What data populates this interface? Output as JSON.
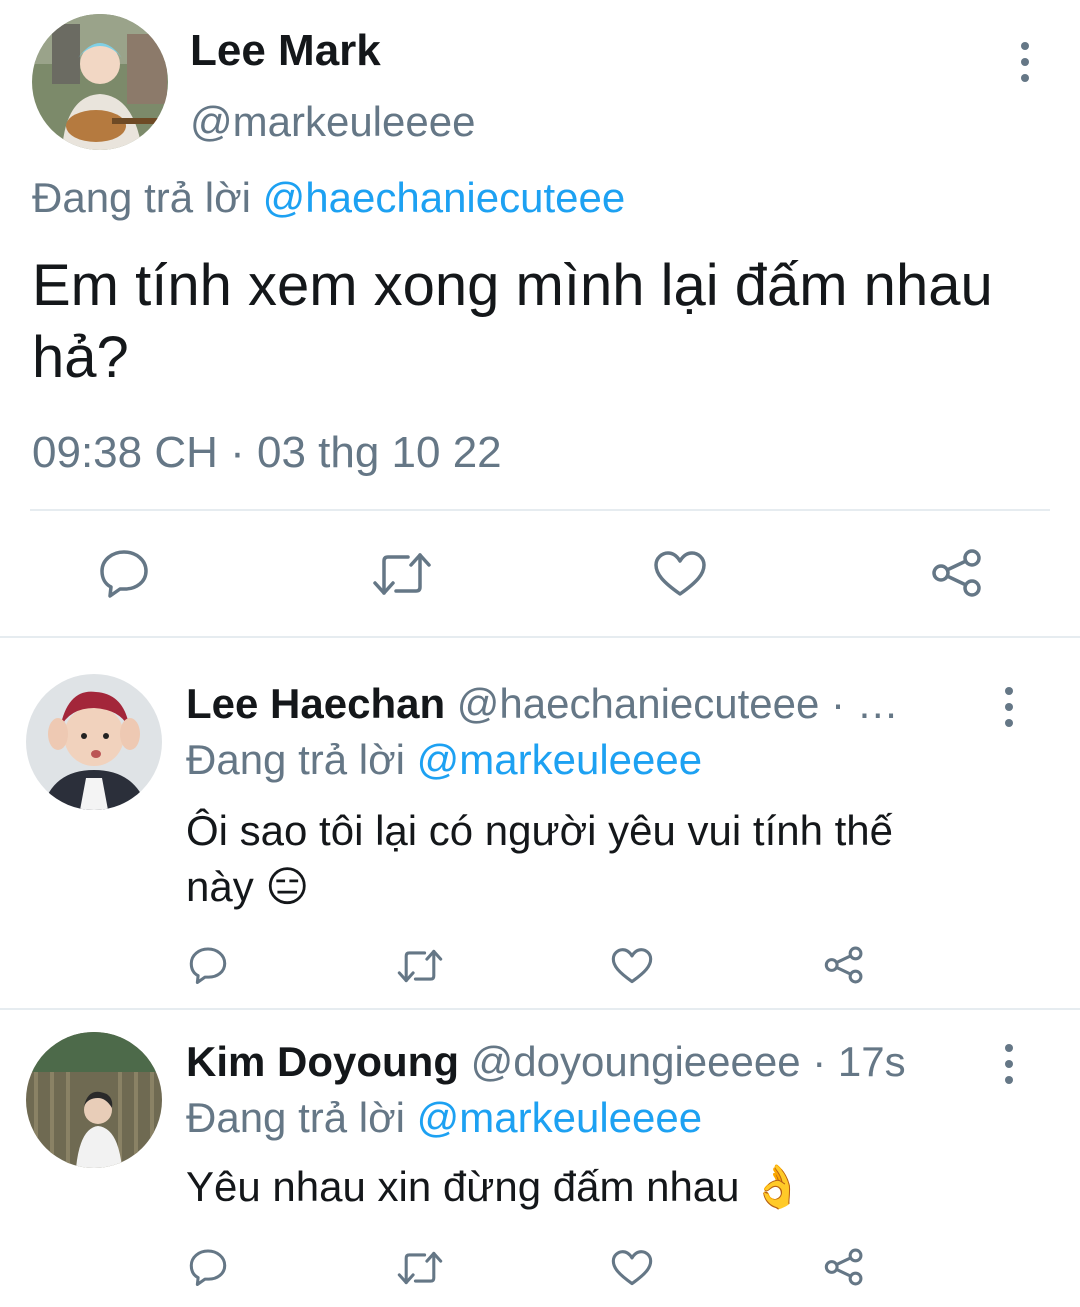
{
  "main_tweet": {
    "display_name": "Lee Mark",
    "handle": "@markeuleeee",
    "replying_prefix": "Đang trả lời",
    "replying_to": "@haechaniecuteee",
    "text_line1": "Em tính xem xong mình lại đấm nhau",
    "text_line2": "hả?",
    "timestamp": "09:38 CH · 03 thg 10 22",
    "actions": [
      "reply-icon",
      "retweet-icon",
      "like-icon",
      "share-icon"
    ]
  },
  "replies": [
    {
      "display_name": "Lee Haechan",
      "handle_meta": "@haechaniecuteee · …",
      "replying_prefix": "Đang trả lời",
      "replying_to": "@markeuleeee",
      "text_line1": "Ôi sao tôi lại có người yêu vui tính thế",
      "text_line2": "này",
      "emoji": "😑"
    },
    {
      "display_name": "Kim Doyoung",
      "handle_meta": "@doyoungieeeee · 17s",
      "replying_prefix": "Đang trả lời",
      "replying_to": "@markeuleeee",
      "text_line1": "Yêu nhau xin đừng đấm nhau",
      "emoji": "👌"
    }
  ],
  "colors": {
    "text": "#14171a",
    "secondary": "#657786",
    "link": "#1da1f2",
    "divider": "#e6ecf0"
  }
}
